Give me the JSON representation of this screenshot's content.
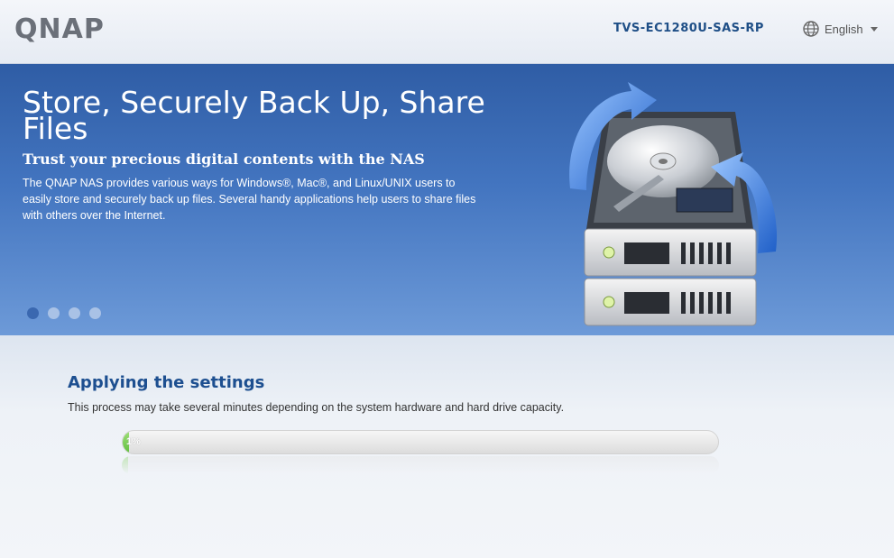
{
  "header": {
    "logo": "QNAP",
    "model": "TVS-EC1280U-SAS-RP",
    "language": "English",
    "language_icon": "globe-icon"
  },
  "banner": {
    "title": "Store, Securely Back Up, Share Files",
    "subtitle": "Trust your precious digital contents with the NAS",
    "description": "The QNAP NAS provides various ways for Windows®, Mac®, and Linux/UNIX users to easily store and securely back up files. Several handy applications help users to share files with others over the Internet.",
    "slide_count": 4,
    "active_slide": 1,
    "illustration": "nas-backup-icon"
  },
  "status": {
    "title": "Applying the settings",
    "description": "This process may take several minutes depending on the system hardware and hard drive capacity.",
    "progress_text": "1%",
    "progress_fraction": 0.01
  },
  "colors": {
    "accent": "#1d4f90",
    "banner": "#4375c0",
    "progress": "#5fbf3c"
  }
}
